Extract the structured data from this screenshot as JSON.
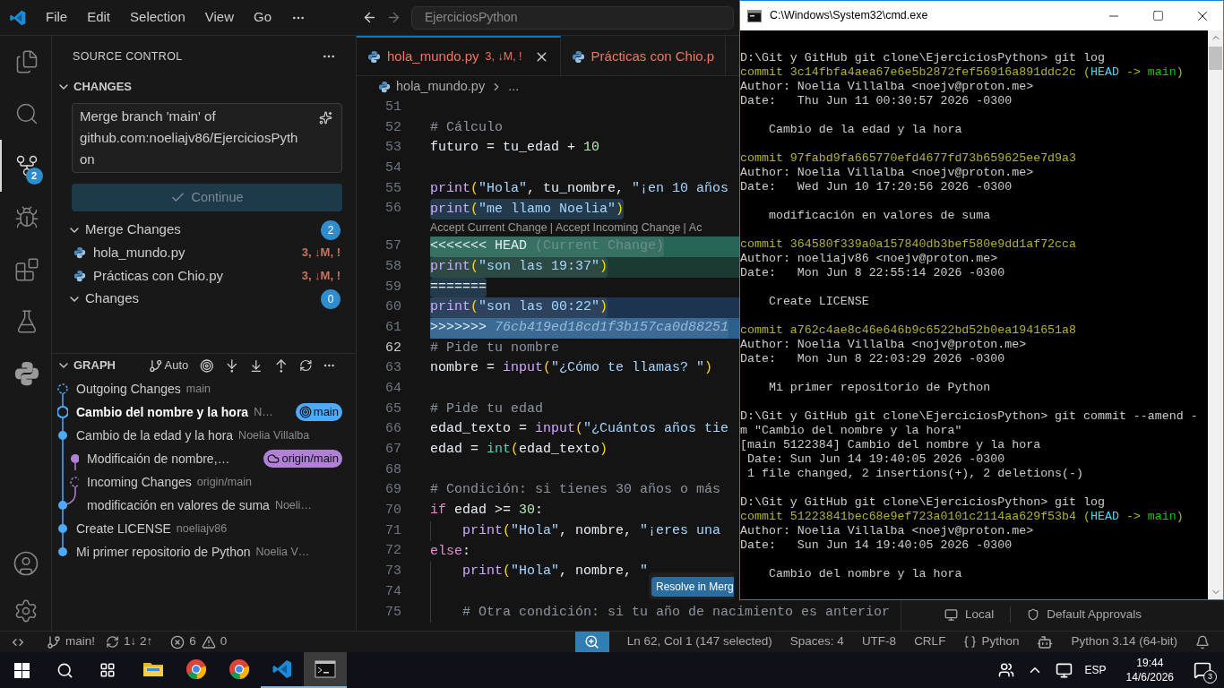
{
  "title_bar": {
    "menu": [
      "File",
      "Edit",
      "Selection",
      "View",
      "Go"
    ],
    "search": {
      "value": "EjerciciosPython"
    }
  },
  "activity_bar": {
    "items": [
      {
        "kind": "files",
        "selected": false
      },
      {
        "kind": "search",
        "selected": false
      },
      {
        "kind": "scm",
        "selected": true,
        "badge": "2"
      },
      {
        "kind": "debug",
        "selected": false
      },
      {
        "kind": "extensions",
        "selected": false
      },
      {
        "kind": "testing",
        "selected": false
      },
      {
        "kind": "python",
        "selected": false
      }
    ]
  },
  "sidebar": {
    "title": "SOURCE CONTROL",
    "section": {
      "label": "CHANGES",
      "expanded": true
    },
    "commit_message": {
      "value": "Merge branch 'main' of github.com:noeliajv86/EjerciciosPython"
    },
    "continue_button": {
      "label": "Continue",
      "disabled": true
    },
    "groups": [
      {
        "label": "Merge Changes",
        "count": "2",
        "expanded": true,
        "files": [
          {
            "name": "hola_mundo.py",
            "status": "3, ↓M, !"
          },
          {
            "name": "Prácticas con Chio.py",
            "status": "3, ↓M, !"
          }
        ]
      },
      {
        "label": "Changes",
        "count": "0",
        "expanded": true
      }
    ]
  },
  "graph": {
    "label": "GRAPH",
    "expanded": true,
    "mode": "Auto",
    "rows": [
      {
        "kind": "outgoing",
        "title": "Outgoing Changes",
        "detail": "main"
      },
      {
        "kind": "head",
        "title": "Cambio del nombre y la hora",
        "detail": "N…",
        "badge": {
          "label": "main",
          "kind": "local",
          "color": "#4daafc"
        }
      },
      {
        "kind": "commit",
        "title": "Cambio de la edad y la hora",
        "detail": "Noelia Villalba"
      },
      {
        "kind": "remote",
        "title": "Modificaión de nombre,…",
        "badge": {
          "label": "origin/main",
          "kind": "remote",
          "color": "#b180d7"
        }
      },
      {
        "kind": "incoming",
        "title": "Incoming Changes",
        "detail": "origin/main"
      },
      {
        "kind": "merge",
        "title": "modificación en valores de suma",
        "detail": "Noeli…"
      },
      {
        "kind": "commit",
        "title": "Create LICENSE",
        "detail": "noeliajv86"
      },
      {
        "kind": "commit",
        "title": "Mi primer repositorio de Python",
        "detail": "Noelia V…"
      }
    ]
  },
  "editor": {
    "tabs": [
      {
        "label": "hola_mundo.py",
        "status": "3, ↓M, !",
        "selected": true
      },
      {
        "label": "Prácticas con Chio.p",
        "selected": false
      }
    ],
    "breadcrumb": [
      "hola_mundo.py",
      "..."
    ],
    "lines": [
      {
        "number": "51",
        "kind": "normal",
        "active": false
      },
      {
        "number": "52",
        "kind": "normal",
        "active": false,
        "tokens": [
          {
            "kind": "comment",
            "text": "# Cálculo"
          }
        ]
      },
      {
        "number": "53",
        "kind": "normal",
        "active": false,
        "tokens": [
          {
            "kind": "plain",
            "text": "futuro = tu_edad + "
          },
          {
            "kind": "num",
            "text": "10"
          }
        ]
      },
      {
        "number": "54",
        "kind": "normal",
        "active": false
      },
      {
        "number": "55",
        "kind": "normal",
        "active": false,
        "tokens": [
          {
            "kind": "fn",
            "text": "print"
          },
          {
            "kind": "paren",
            "text": "("
          },
          {
            "kind": "str",
            "text": "\"Hola\""
          },
          {
            "kind": "plain",
            "text": ", tu_nombre, "
          },
          {
            "kind": "str",
            "text": "\"¡en 10 años"
          }
        ]
      },
      {
        "number": "56",
        "kind": "normal",
        "active": false,
        "selected": true,
        "tokens": [
          {
            "kind": "fn",
            "text": "print"
          },
          {
            "kind": "paren",
            "text": "("
          },
          {
            "kind": "str",
            "text": "\"me llamo Noelia\""
          },
          {
            "kind": "paren",
            "text": ")"
          }
        ]
      },
      {
        "kind": "codelens",
        "actions": [
          "Accept Current Change",
          "Accept Incoming Change",
          "Ac"
        ],
        "separator": "|"
      },
      {
        "number": "57",
        "kind": "current-marker",
        "active": false,
        "selected": true,
        "tokens": [
          {
            "kind": "plain",
            "text": "<<<<<<< HEAD "
          },
          {
            "kind": "dim",
            "text": "(Current Change)"
          }
        ]
      },
      {
        "number": "58",
        "kind": "current",
        "active": false,
        "selected": true,
        "tokens": [
          {
            "kind": "fn",
            "text": "print"
          },
          {
            "kind": "paren",
            "text": "("
          },
          {
            "kind": "str",
            "text": "\"son las 19:37\""
          },
          {
            "kind": "paren",
            "text": ")"
          }
        ]
      },
      {
        "number": "59",
        "kind": "separator",
        "active": false,
        "selected": true,
        "tokens": [
          {
            "kind": "plain",
            "text": "======="
          }
        ]
      },
      {
        "number": "60",
        "kind": "incoming",
        "active": false,
        "selected": true,
        "tokens": [
          {
            "kind": "fn",
            "text": "print"
          },
          {
            "kind": "paren",
            "text": "("
          },
          {
            "kind": "str",
            "text": "\"son las 00:22\""
          },
          {
            "kind": "paren",
            "text": ")"
          }
        ]
      },
      {
        "number": "61",
        "kind": "incoming-marker",
        "active": false,
        "selected": true,
        "tokens": [
          {
            "kind": "plain",
            "text": ">>>>>>> "
          },
          {
            "kind": "hash",
            "text": "76cb419ed18cd1f3b157ca0d88251"
          }
        ]
      },
      {
        "number": "62",
        "kind": "normal",
        "active": true,
        "tokens": [
          {
            "kind": "comment",
            "text": "# Pide tu nombre"
          }
        ]
      },
      {
        "number": "63",
        "kind": "normal",
        "active": false,
        "tokens": [
          {
            "kind": "plain",
            "text": "nombre = "
          },
          {
            "kind": "fn",
            "text": "input"
          },
          {
            "kind": "paren",
            "text": "("
          },
          {
            "kind": "str",
            "text": "\"¿Cómo te llamas? \""
          },
          {
            "kind": "paren",
            "text": ")"
          }
        ]
      },
      {
        "number": "64",
        "kind": "normal",
        "active": false
      },
      {
        "number": "65",
        "kind": "normal",
        "active": false,
        "tokens": [
          {
            "kind": "comment",
            "text": "# Pide tu edad"
          }
        ]
      },
      {
        "number": "66",
        "kind": "normal",
        "active": false,
        "tokens": [
          {
            "kind": "plain",
            "text": "edad_texto = "
          },
          {
            "kind": "fn",
            "text": "input"
          },
          {
            "kind": "paren",
            "text": "("
          },
          {
            "kind": "str",
            "text": "\"¿Cuántos años tie"
          }
        ]
      },
      {
        "number": "67",
        "kind": "normal",
        "active": false,
        "tokens": [
          {
            "kind": "plain",
            "text": "edad = "
          },
          {
            "kind": "builtin",
            "text": "int"
          },
          {
            "kind": "paren",
            "text": "("
          },
          {
            "kind": "plain",
            "text": "edad_texto"
          },
          {
            "kind": "paren",
            "text": ")"
          }
        ]
      },
      {
        "number": "68",
        "kind": "normal",
        "active": false
      },
      {
        "number": "69",
        "kind": "normal",
        "active": false,
        "tokens": [
          {
            "kind": "comment",
            "text": "# Condición: si tienes 30 años o más"
          }
        ]
      },
      {
        "number": "70",
        "kind": "normal",
        "active": false,
        "tokens": [
          {
            "kind": "kw",
            "text": "if"
          },
          {
            "kind": "plain",
            "text": " edad >= "
          },
          {
            "kind": "num",
            "text": "30"
          },
          {
            "kind": "plain",
            "text": ":"
          }
        ]
      },
      {
        "number": "71",
        "kind": "normal",
        "active": false,
        "indent": true,
        "tokens": [
          {
            "kind": "fn",
            "text": "print"
          },
          {
            "kind": "paren",
            "text": "("
          },
          {
            "kind": "str",
            "text": "\"Hola\""
          },
          {
            "kind": "plain",
            "text": ", nombre, "
          },
          {
            "kind": "str",
            "text": "\"¡eres una"
          }
        ]
      },
      {
        "number": "72",
        "kind": "normal",
        "active": false,
        "tokens": [
          {
            "kind": "kw",
            "text": "else"
          },
          {
            "kind": "plain",
            "text": ":"
          }
        ]
      },
      {
        "number": "73",
        "kind": "normal",
        "active": false,
        "indent": true,
        "tokens": [
          {
            "kind": "fn",
            "text": "print"
          },
          {
            "kind": "paren",
            "text": "("
          },
          {
            "kind": "str",
            "text": "\"Hola\""
          },
          {
            "kind": "plain",
            "text": ", nombre, "
          },
          {
            "kind": "str",
            "text": "\""
          }
        ]
      },
      {
        "number": "74",
        "kind": "normal",
        "active": false,
        "indent": true
      },
      {
        "number": "75",
        "kind": "normal",
        "active": false,
        "indent": true,
        "tokens": [
          {
            "kind": "comment",
            "text": "# Otra condición: si tu año de nacimiento es anterior"
          }
        ]
      }
    ],
    "resolve_button": "Resolve in Merg"
  },
  "side_panel": {
    "items": [
      {
        "kind": "local",
        "label": "Local"
      },
      {
        "kind": "approvals",
        "label": "Default Approvals"
      }
    ]
  },
  "status_bar": {
    "left": [
      {
        "kind": "remote"
      },
      {
        "kind": "branch",
        "text": "main!"
      },
      {
        "kind": "sync",
        "text": "1↓ 2↑"
      },
      {
        "kind": "errors",
        "text": "6"
      },
      {
        "kind": "warnings",
        "text": "0"
      }
    ],
    "right": [
      {
        "kind": "zoom"
      },
      {
        "kind": "text",
        "text": "Ln 62, Col 1 (147 selected)"
      },
      {
        "kind": "text",
        "text": "Spaces: 4"
      },
      {
        "kind": "text",
        "text": "UTF-8"
      },
      {
        "kind": "text",
        "text": "CRLF"
      },
      {
        "kind": "language",
        "text": "Python"
      },
      {
        "kind": "copilot"
      },
      {
        "kind": "text",
        "text": "Python 3.14 (64-bit)"
      },
      {
        "kind": "bell"
      }
    ]
  },
  "terminal": {
    "title": "C:\\Windows\\System32\\cmd.exe",
    "lines": [
      {
        "kind": "blank"
      },
      {
        "kind": "plain",
        "text": "D:\\Git y GitHub git clone\\EjerciciosPython> git log"
      },
      {
        "kind": "commit",
        "text": "commit 3c14fbfa4aea67e6e5b2872fef56916a891ddc2c",
        "refs": [
          {
            "kind": "paren",
            "text": " ("
          },
          {
            "kind": "head",
            "text": "HEAD"
          },
          {
            "kind": "paren",
            "text": " -> "
          },
          {
            "kind": "branch",
            "text": "main"
          },
          {
            "kind": "paren",
            "text": ")"
          }
        ]
      },
      {
        "kind": "plain",
        "text": "Author: Noelia Villalba <noejv@proton.me>"
      },
      {
        "kind": "plain",
        "text": "Date:   Thu Jun 11 00:30:57 2026 -0300"
      },
      {
        "kind": "blank"
      },
      {
        "kind": "plain",
        "text": "    Cambio de la edad y la hora"
      },
      {
        "kind": "blank"
      },
      {
        "kind": "commit",
        "text": "commit 97fabd9fa665770efd4677fd73b659625ee7d9a3"
      },
      {
        "kind": "plain",
        "text": "Author: Noelia Villalba <noejv@proton.me>"
      },
      {
        "kind": "plain",
        "text": "Date:   Wed Jun 10 17:20:56 2026 -0300"
      },
      {
        "kind": "blank"
      },
      {
        "kind": "plain",
        "text": "    modificación en valores de suma"
      },
      {
        "kind": "blank"
      },
      {
        "kind": "commit",
        "text": "commit 364580f339a0a157840db3bef580e9dd1af72cca"
      },
      {
        "kind": "plain",
        "text": "Author: noeliajv86 <noejv@proton.me>"
      },
      {
        "kind": "plain",
        "text": "Date:   Mon Jun 8 22:55:14 2026 -0300"
      },
      {
        "kind": "blank"
      },
      {
        "kind": "plain",
        "text": "    Create LICENSE"
      },
      {
        "kind": "blank"
      },
      {
        "kind": "commit",
        "text": "commit a762c4ae8c46e646b9c6522bd52b0ea1941651a8"
      },
      {
        "kind": "plain",
        "text": "Author: Noelia Villalba <nojv@proton.me>"
      },
      {
        "kind": "plain",
        "text": "Date:   Mon Jun 8 22:03:29 2026 -0300"
      },
      {
        "kind": "blank"
      },
      {
        "kind": "plain",
        "text": "    Mi primer repositorio de Python"
      },
      {
        "kind": "blank"
      },
      {
        "kind": "plain",
        "text": "D:\\Git y GitHub git clone\\EjerciciosPython> git commit --amend -"
      },
      {
        "kind": "plain",
        "text": "m \"Cambio del nombre y la hora\""
      },
      {
        "kind": "plain",
        "text": "[main 5122384] Cambio del nombre y la hora"
      },
      {
        "kind": "plain",
        "text": " Date: Sun Jun 14 19:40:05 2026 -0300"
      },
      {
        "kind": "plain",
        "text": " 1 file changed, 2 insertions(+), 2 deletions(-)"
      },
      {
        "kind": "blank"
      },
      {
        "kind": "plain",
        "text": "D:\\Git y GitHub git clone\\EjerciciosPython> git log"
      },
      {
        "kind": "commit",
        "text": "commit 51223841bec68e9ef723a0101c2114aa629f53b4",
        "refs": [
          {
            "kind": "paren",
            "text": " ("
          },
          {
            "kind": "head",
            "text": "HEAD"
          },
          {
            "kind": "paren",
            "text": " -> "
          },
          {
            "kind": "branch",
            "text": "main"
          },
          {
            "kind": "paren",
            "text": ")"
          }
        ]
      },
      {
        "kind": "plain",
        "text": "Author: Noelia Villalba <noejv@proton.me>"
      },
      {
        "kind": "plain",
        "text": "Date:   Sun Jun 14 19:40:05 2026 -0300"
      },
      {
        "kind": "blank"
      },
      {
        "kind": "plain",
        "text": "    Cambio del nombre y la hora"
      }
    ]
  },
  "taskbar": {
    "apps": [
      {
        "kind": "explorer",
        "selected": false,
        "running": false
      },
      {
        "kind": "chrome",
        "selected": false,
        "running": false
      },
      {
        "kind": "chrome",
        "selected": false,
        "running": false
      },
      {
        "kind": "vscode",
        "selected": false,
        "running": true
      },
      {
        "kind": "cmd",
        "selected": true,
        "running": true
      }
    ],
    "tray": {
      "language": "ESP",
      "time": "19:44",
      "date": "14/6/2026",
      "notifications": "3"
    }
  }
}
